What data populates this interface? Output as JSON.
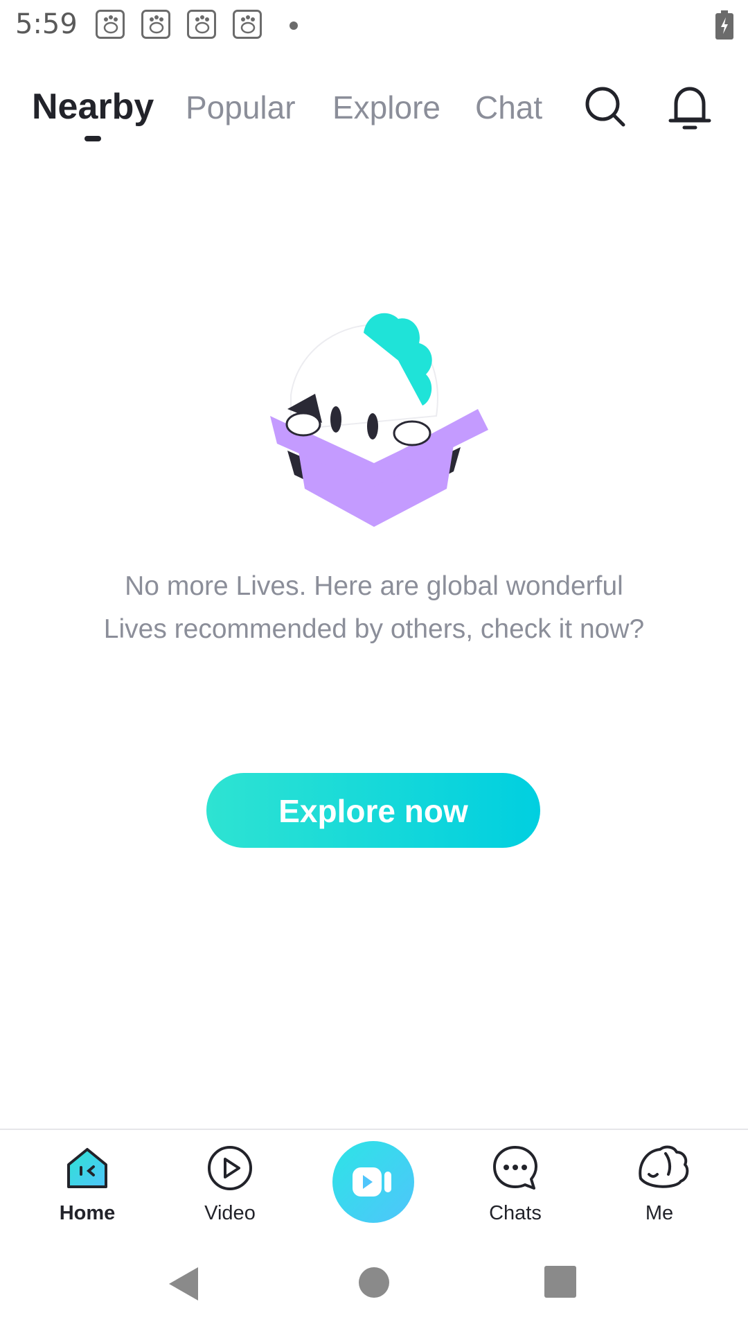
{
  "status_bar": {
    "time": "5:59",
    "notification_icons": [
      "baidu-paw-icon",
      "baidu-paw-icon",
      "baidu-paw-icon",
      "baidu-paw-icon"
    ],
    "battery_state": "charging"
  },
  "top_tabs": {
    "items": [
      {
        "label": "Nearby",
        "active": true
      },
      {
        "label": "Popular",
        "active": false
      },
      {
        "label": "Explore",
        "active": false
      },
      {
        "label": "Chat",
        "active": false
      }
    ],
    "icons": [
      "search-icon",
      "bell-icon"
    ]
  },
  "empty_state": {
    "illustration": "mascot-in-box-illustration",
    "message": "No more Lives. Here are global wonderful Lives recommended by others, check it now?",
    "button_label": "Explore now"
  },
  "bottom_nav": {
    "items": [
      {
        "label": "Home",
        "icon": "home-icon",
        "active": true
      },
      {
        "label": "Video",
        "icon": "play-circle-icon",
        "active": false
      },
      {
        "label": "",
        "icon": "live-camera-icon",
        "active": false
      },
      {
        "label": "Chats",
        "icon": "chat-bubble-icon",
        "active": false
      },
      {
        "label": "Me",
        "icon": "mascot-head-icon",
        "active": false
      }
    ]
  },
  "colors": {
    "accent_start": "#2ee3d2",
    "accent_end": "#00cfe0",
    "text_primary": "#22232a",
    "text_secondary": "#8b8e99",
    "box_purple": "#c49bff"
  }
}
